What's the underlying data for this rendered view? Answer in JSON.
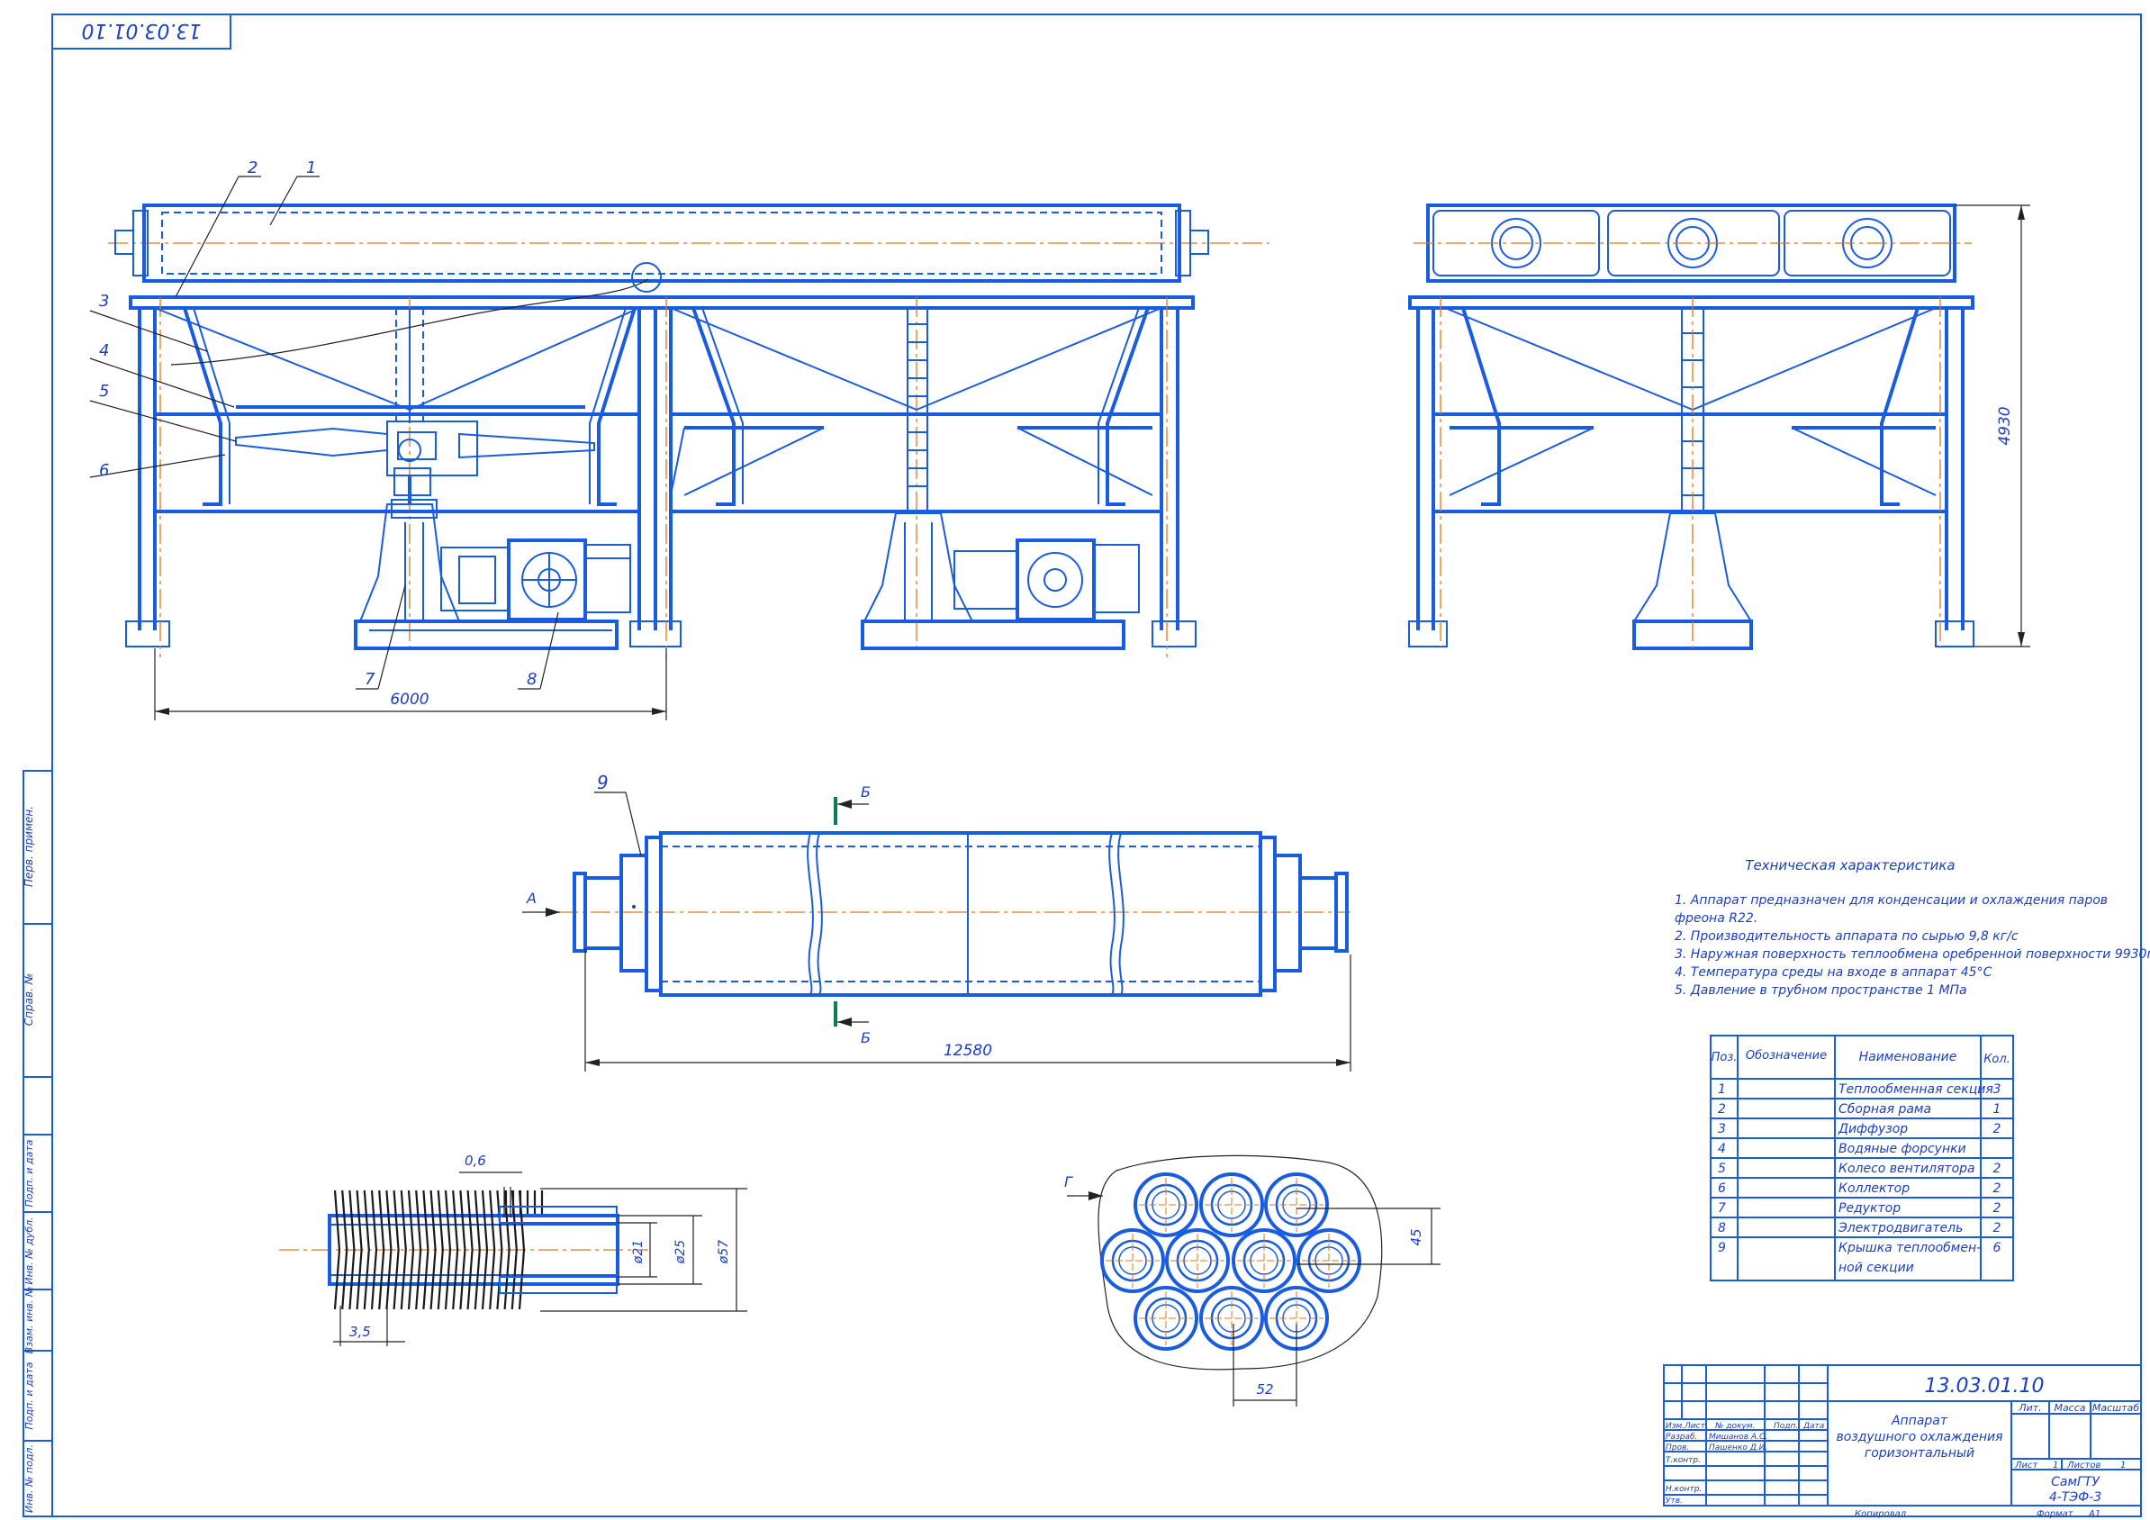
{
  "drawing": {
    "code_top": "13.03.01.10",
    "code_stamp": "13.03.01.10"
  },
  "callouts": [
    "1",
    "2",
    "3",
    "4",
    "5",
    "6",
    "7",
    "8",
    "9"
  ],
  "dimensions": {
    "front_width": "6000",
    "side_height": "4930",
    "tube_length": "12580",
    "fin_pitch_top": "0,6",
    "fin_pitch_bottom": "3,5",
    "d21": "ø21",
    "d25": "ø25",
    "d57": "ø57",
    "bundle_45": "45",
    "bundle_52": "52"
  },
  "views": {
    "arrow_a": "A",
    "section_b_top": "Б",
    "section_b_bottom": "Б",
    "view_g": "Г"
  },
  "tech": {
    "title": "Техническая характеристика",
    "lines": [
      "1. Аппарат предназначен для конденсации и охлаждения паров",
      "фреона R22.",
      "2. Производительность аппарата по сырью 9,8 кг/с",
      "3. Наружная поверхность теплообмена  оребренной поверхности 9930м2.",
      "4. Температура среды на входе в аппарат 45°С",
      "5. Давление в трубном пространстве 1 МПа"
    ]
  },
  "parts": {
    "headers": [
      "Поз.",
      "Обозначение",
      "Наименование",
      "Кол."
    ],
    "rows": [
      {
        "pos": "1",
        "name": "Теплообменная секция",
        "qty": "3"
      },
      {
        "pos": "2",
        "name": "Сборная рама",
        "qty": "1"
      },
      {
        "pos": "3",
        "name": "Диффузор",
        "qty": "2"
      },
      {
        "pos": "4",
        "name": "Водяные форсунки",
        "qty": ""
      },
      {
        "pos": "5",
        "name": "Колесо вентилятора",
        "qty": "2"
      },
      {
        "pos": "6",
        "name": "Коллектор",
        "qty": "2"
      },
      {
        "pos": "7",
        "name": "Редуктор",
        "qty": "2"
      },
      {
        "pos": "8",
        "name": "Электродвигатель",
        "qty": "2"
      },
      {
        "pos": "9",
        "name": "Крышка теплообмен-",
        "name2": "ной секции",
        "qty": "6"
      }
    ]
  },
  "stamp": {
    "title_lines": [
      "Аппарат",
      "воздушного охлаждения",
      "горизонтальный"
    ],
    "col_lit": "Лит.",
    "col_mass": "Масса",
    "col_scale": "Масштаб",
    "row_izm": "Изм.",
    "row_list": "Лист",
    "row_doc": "№ докум.",
    "row_sign": "Подп.",
    "row_date": "Дата",
    "razrab": "Разраб.",
    "razrab_name": "Мишанов А.С.",
    "prov": "Пров.",
    "prov_name": "Пашенко Д.И.",
    "tkontr": "Т.контр.",
    "nkontr": "Н.контр.",
    "utv": "Утв.",
    "sheet": "Лист",
    "sheet_num": "1",
    "sheets": "Листов",
    "sheets_num": "1",
    "org1": "СамГТУ",
    "org2": "4-ТЭФ-3",
    "copied": "Копировал",
    "format": "Формат",
    "format_val": "А1"
  },
  "sidebar": {
    "perv": "Перв. примен.",
    "sprav": "Справ. №",
    "podp_data1": "Подп. и дата",
    "inv_dubl": "Инв. № дубл.",
    "vzam": "Взам. инв. №",
    "podp_data2": "Подп. и дата",
    "inv_podl": "Инв. № подл."
  }
}
